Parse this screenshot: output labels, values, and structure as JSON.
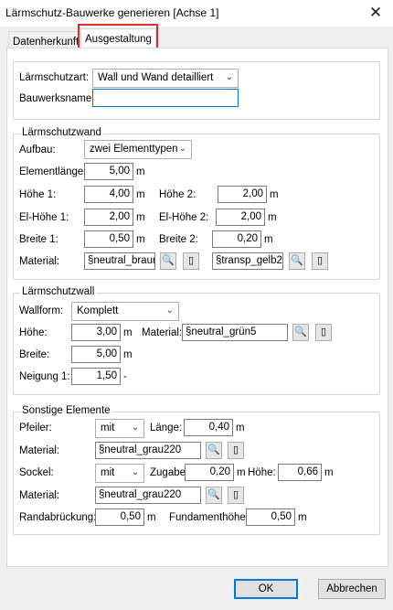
{
  "window": {
    "title": "Lärmschutz-Bauwerke generieren [Achse 1]",
    "close_glyph": "✕"
  },
  "tabs": [
    {
      "label": "Datenherkunft"
    },
    {
      "label": "Ausgestaltung"
    }
  ],
  "header": {
    "laermschutzart_label": "Lärmschutzart:",
    "laermschutzart_value": "Wall und Wand detailliert",
    "bauwerksname_label": "Bauwerksname:",
    "bauwerksname_value": ""
  },
  "wand": {
    "legend": "Lärmschutzwand",
    "aufbau_label": "Aufbau:",
    "aufbau_value": "zwei Elementtypen",
    "elementlaenge_label": "Elementlänge:",
    "elementlaenge_value": "5,00",
    "hoehe1_label": "Höhe 1:",
    "hoehe1_value": "4,00",
    "hoehe2_label": "Höhe 2:",
    "hoehe2_value": "2,00",
    "elhoehe1_label": "El-Höhe 1:",
    "elhoehe1_value": "2,00",
    "elhoehe2_label": "El-Höhe 2:",
    "elhoehe2_value": "2,00",
    "breite1_label": "Breite 1:",
    "breite1_value": "0,50",
    "breite2_label": "Breite 2:",
    "breite2_value": "0,20",
    "material_label": "Material:",
    "material1_value": "§neutral_braun",
    "material2_value": "§transp_gelb2"
  },
  "wall": {
    "legend": "Lärmschutzwall",
    "wallform_label": "Wallform:",
    "wallform_value": "Komplett",
    "hoehe_label": "Höhe:",
    "hoehe_value": "3,00",
    "material_label": "Material:",
    "material_value": "§neutral_grün5",
    "breite_label": "Breite:",
    "breite_value": "5,00",
    "neigung_label": "Neigung 1:",
    "neigung_value": "1,50",
    "neigung_unit": "-"
  },
  "sonstige": {
    "legend": "Sonstige Elemente",
    "pfeiler_label": "Pfeiler:",
    "pfeiler_value": "mit",
    "laenge_label": "Länge:",
    "laenge_value": "0,40",
    "material_label": "Material:",
    "pfeiler_material_value": "§neutral_grau220",
    "sockel_label": "Sockel:",
    "sockel_value": "mit",
    "zugabe_label": "Zugabe:",
    "zugabe_value": "0,20",
    "hoehe_label": "Höhe:",
    "hoehe_value": "0,66",
    "sockel_material_value": "§neutral_grau220",
    "randabrueckung_label": "Randabrückung:",
    "randabrueckung_value": "0,50",
    "fundamenthoehe_label": "Fundamenthöhe:",
    "fundamenthoehe_value": "0,50"
  },
  "units": {
    "m": "m"
  },
  "icons": {
    "browse": "🔍",
    "material_picker": "▯",
    "dropdown": "⌄"
  },
  "buttons": {
    "ok": "OK",
    "cancel": "Abbrechen"
  },
  "colors": {
    "tab_highlight": "#e02b2b",
    "focus": "#0078d7"
  }
}
